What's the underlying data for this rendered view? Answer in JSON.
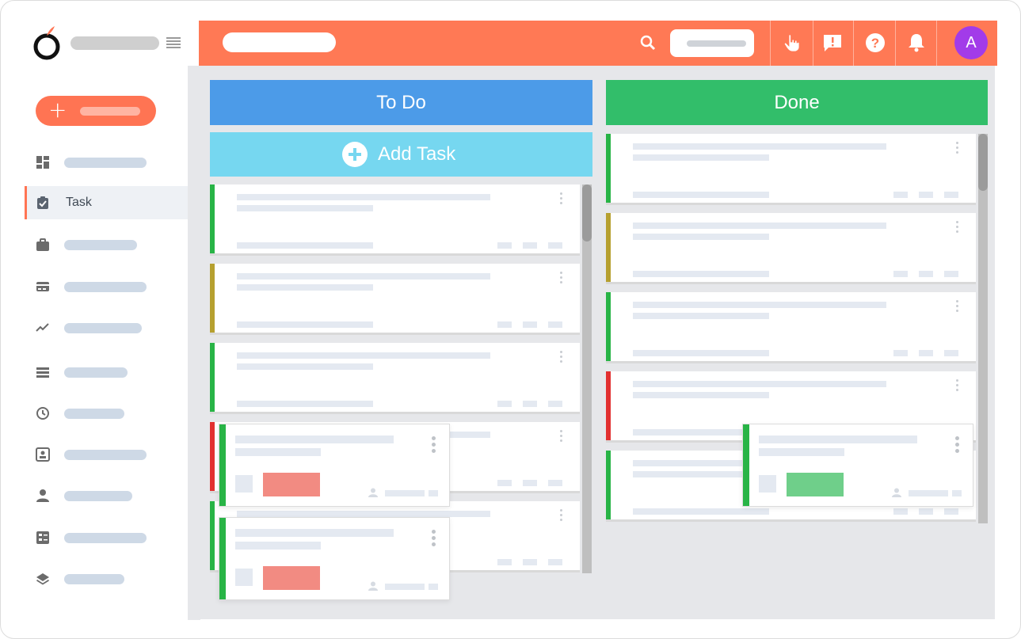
{
  "sidebar": {
    "active_item_label": "Task",
    "items": [
      {
        "name": "dashboard",
        "icon": "dashboard-icon"
      },
      {
        "name": "task",
        "icon": "clipboard-check-icon",
        "label": "Task"
      },
      {
        "name": "projects",
        "icon": "briefcase-icon"
      },
      {
        "name": "billing",
        "icon": "credit-card-icon"
      },
      {
        "name": "reports",
        "icon": "trending-icon"
      },
      {
        "name": "list",
        "icon": "list-icon"
      },
      {
        "name": "timesheet",
        "icon": "clock-icon"
      },
      {
        "name": "contacts",
        "icon": "contact-card-icon"
      },
      {
        "name": "users",
        "icon": "person-icon"
      },
      {
        "name": "forms",
        "icon": "checklist-icon"
      },
      {
        "name": "layers",
        "icon": "layers-icon"
      }
    ]
  },
  "header": {
    "avatar_initial": "A",
    "icons": [
      "search-icon",
      "hand-pointer-icon",
      "feedback-icon",
      "help-icon",
      "bell-icon"
    ]
  },
  "board": {
    "columns": [
      {
        "title": "To Do",
        "color": "#4c9be8"
      },
      {
        "title": "Done",
        "color": "#32be6a"
      }
    ],
    "add_task_label": "Add Task",
    "todo_cards": [
      "#28b446",
      "#b6a02f",
      "#28b446",
      "#e23030",
      "#28b446"
    ],
    "done_cards": [
      "#28b446",
      "#b6a02f",
      "#28b446",
      "#e23030",
      "#28b446"
    ],
    "drag_cards": [
      {
        "column": "todo",
        "bar_color": "#28b446",
        "tag_color": "#f28b82"
      },
      {
        "column": "todo",
        "bar_color": "#28b446",
        "tag_color": "#f28b82"
      },
      {
        "column": "done",
        "bar_color": "#28b446",
        "tag_color": "#6fcf8a"
      }
    ]
  },
  "colors": {
    "accent": "#ff7955",
    "todo": "#4c9be8",
    "done": "#32be6a",
    "add_task": "#76d7f0",
    "avatar": "#a23be9"
  }
}
